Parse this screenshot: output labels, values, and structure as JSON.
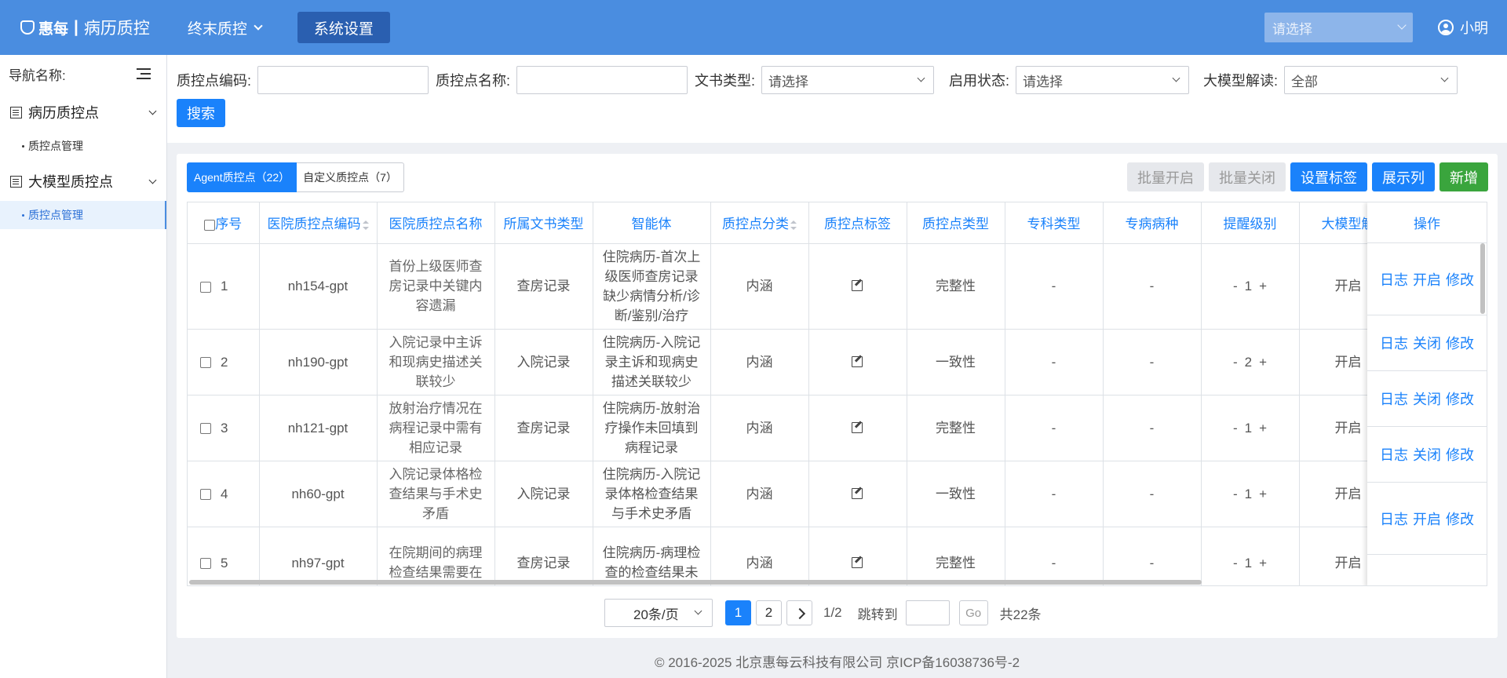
{
  "app": {
    "logo_text": "惠每",
    "logo_sep": "|",
    "title": "病历质控"
  },
  "topnav": {
    "dropdown_label": "终末质控",
    "button_label": "系统设置",
    "select_placeholder": "请选择",
    "user_name": "小明"
  },
  "sidebar": {
    "header": "导航名称:",
    "groups": [
      {
        "label": "病历质控点",
        "items": [
          {
            "label": "质控点管理"
          }
        ]
      },
      {
        "label": "大模型质控点",
        "items": [
          {
            "label": "质控点管理"
          }
        ]
      }
    ]
  },
  "filters": {
    "code_label": "质控点编码:",
    "name_label": "质控点名称:",
    "doc_type_label": "文书类型:",
    "doc_type_value": "请选择",
    "status_label": "启用状态:",
    "status_value": "请选择",
    "llm_label": "大模型解读:",
    "llm_value": "全部",
    "search_label": "搜索"
  },
  "tabs": [
    {
      "label": "Agent质控点（22）"
    },
    {
      "label": "自定义质控点（7）"
    }
  ],
  "actions": {
    "batch_enable": "批量开启",
    "batch_disable": "批量关闭",
    "set_tag": "设置标签",
    "show_columns": "展示列",
    "add_new": "新增"
  },
  "table": {
    "columns": [
      "序号",
      "医院质控点编码",
      "医院质控点名称",
      "所属文书类型",
      "智能体",
      "质控点分类",
      "质控点标签",
      "质控点类型",
      "专科类型",
      "专病病种",
      "提醒级别",
      "大模型解",
      "操作"
    ],
    "rows": [
      {
        "index": "1",
        "code": "nh154-gpt",
        "name": "首份上级医师查房记录中关键内容遗漏",
        "doc_type": "查房记录",
        "agent": "住院病历-首次上级医师查房记录缺少病情分析/诊断/鉴别/治疗",
        "category": "内涵",
        "qc_type": "完整性",
        "specialty": "-",
        "disease": "-",
        "level": "1",
        "llm": "开启",
        "op_log": "日志",
        "op_toggle": "开启",
        "op_edit": "修改"
      },
      {
        "index": "2",
        "code": "nh190-gpt",
        "name": "入院记录中主诉和现病史描述关联较少",
        "doc_type": "入院记录",
        "agent": "住院病历-入院记录主诉和现病史描述关联较少",
        "category": "内涵",
        "qc_type": "一致性",
        "specialty": "-",
        "disease": "-",
        "level": "2",
        "llm": "开启",
        "op_log": "日志",
        "op_toggle": "关闭",
        "op_edit": "修改"
      },
      {
        "index": "3",
        "code": "nh121-gpt",
        "name": "放射治疗情况在病程记录中需有相应记录",
        "doc_type": "查房记录",
        "agent": "住院病历-放射治疗操作未回填到病程记录",
        "category": "内涵",
        "qc_type": "完整性",
        "specialty": "-",
        "disease": "-",
        "level": "1",
        "llm": "开启",
        "op_log": "日志",
        "op_toggle": "关闭",
        "op_edit": "修改"
      },
      {
        "index": "4",
        "code": "nh60-gpt",
        "name": "入院记录体格检查结果与手术史矛盾",
        "doc_type": "入院记录",
        "agent": "住院病历-入院记录体格检查结果与手术史矛盾",
        "category": "内涵",
        "qc_type": "一致性",
        "specialty": "-",
        "disease": "-",
        "level": "1",
        "llm": "开启",
        "op_log": "日志",
        "op_toggle": "关闭",
        "op_edit": "修改"
      },
      {
        "index": "5",
        "code": "nh97-gpt",
        "name": "在院期间的病理检查结果需要在",
        "doc_type": "查房记录",
        "agent": "住院病历-病理检查的检查结果未",
        "category": "内涵",
        "qc_type": "完整性",
        "specialty": "-",
        "disease": "-",
        "level": "1",
        "llm": "开启",
        "op_log": "日志",
        "op_toggle": "开启",
        "op_edit": "修改"
      }
    ],
    "level_minus": "-",
    "level_plus": "+"
  },
  "pager": {
    "page_size": "20条/页",
    "pages": [
      "1",
      "2"
    ],
    "page_info": "1/2",
    "jump_label": "跳转到",
    "go_label": "Go",
    "total": "共22条"
  },
  "footer": "© 2016-2025 北京惠每云科技有限公司 京ICP备16038736号-2"
}
